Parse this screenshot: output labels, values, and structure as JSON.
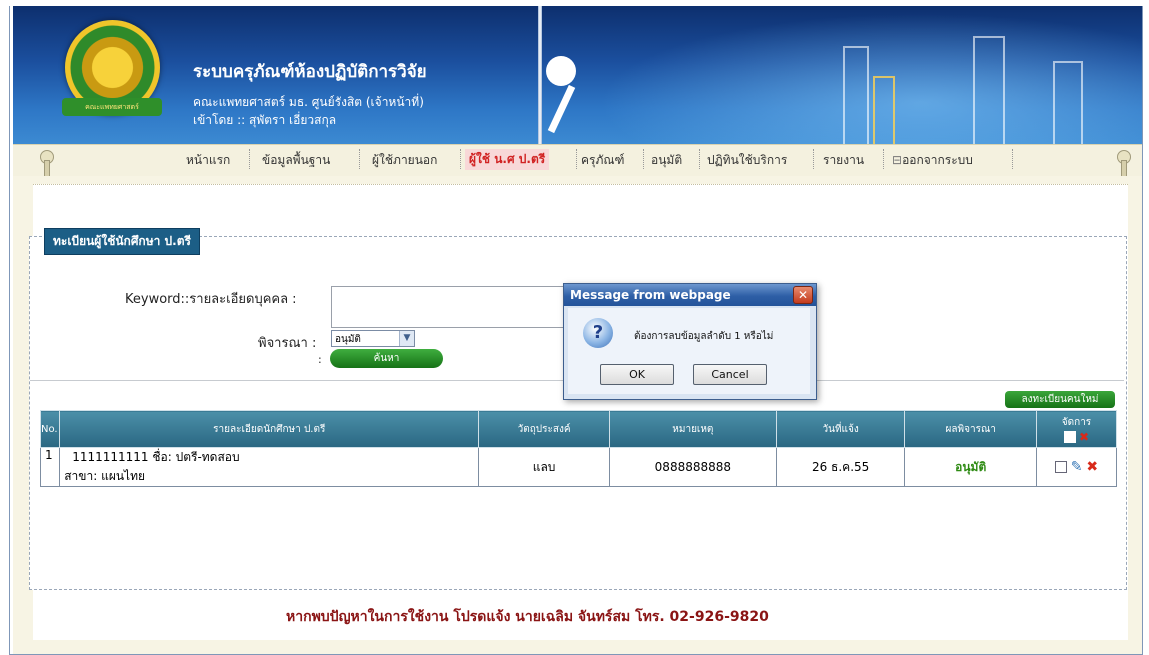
{
  "header": {
    "title": "ระบบครุภัณฑ์ห้องปฏิบัติการวิจัย",
    "subtitle": "คณะแพทยศาสตร์ มธ. ศูนย์รังสิต (เจ้าหน้าที่)",
    "login_user": "เข้าโดย :: สุพัตรา เอี่ยวสกุล",
    "logo_text": "คณะแพทยศาสตร์"
  },
  "nav": {
    "items": [
      {
        "label": "หน้าแรก"
      },
      {
        "label": "ข้อมูลพื้นฐาน"
      },
      {
        "label": "ผู้ใช้ภายนอก"
      },
      {
        "label": "ผู้ใช้ น.ศ ป.ตรี"
      },
      {
        "label": "ครุภัณฑ์"
      },
      {
        "label": "อนุมัติ"
      },
      {
        "label": "ปฏิทินใช้บริการ"
      },
      {
        "label": "รายงาน"
      },
      {
        "label": "ออกจากระบบ"
      }
    ],
    "active_index": 3
  },
  "section": {
    "legend": "ทะเบียนผู้ใช้นักศึกษา ป.ตรี"
  },
  "search": {
    "keyword_label": "Keyword::รายละเอียดบุคคล :",
    "keyword_value": "",
    "status_label": "พิจารณา :",
    "status_value": "อนุมัติ",
    "colon": ":",
    "search_button": "ค้นหา"
  },
  "table": {
    "add_button": "ลงทะเบียนคนใหม่",
    "headers": [
      "No.",
      "รายละเอียดนักศึกษา ป.ตรี",
      "วัตถุประสงค์",
      "หมายเหตุ",
      "วันที่แจ้ง",
      "ผลพิจารณา",
      "จัดการ"
    ],
    "rows": [
      {
        "no": "1",
        "detail_line1": "1111111111 ชื่อ: ปตรี-ทดสอบ",
        "detail_line2": "สาขา: แผนไทย",
        "purpose": "แลบ",
        "note": "0888888888",
        "date": "26 ธ.ค.55",
        "result": "อนุมัติ"
      }
    ]
  },
  "footer": {
    "text": "หากพบปัญหาในการใช้งาน โปรดแจ้ง นายเฉลิม จันทร์สม โทร. 02-926-9820"
  },
  "dialog": {
    "title": "Message from webpage",
    "message": "ต้องการลบข้อมูลลำดับ 1 หรือไม่",
    "ok_label": "OK",
    "cancel_label": "Cancel",
    "close_glyph": "✕",
    "icon_glyph": "?"
  },
  "colors": {
    "banner": "#1b4f9e",
    "nav_active": "#d12323",
    "table_header": "#2a6782",
    "approved_text": "#2d8a12",
    "footer_text": "#8a1414"
  }
}
